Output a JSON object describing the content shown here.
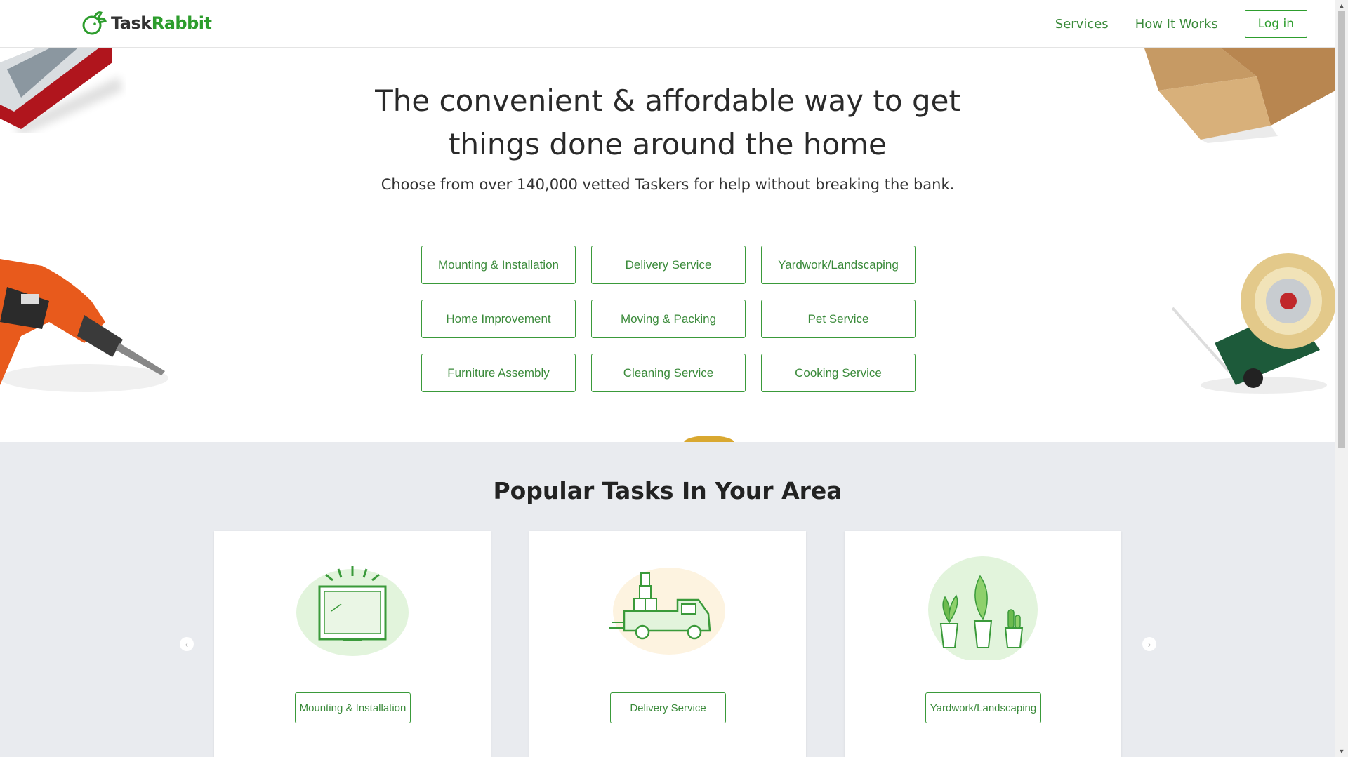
{
  "header": {
    "logo_part1": "Task",
    "logo_part2": "Rabbit",
    "nav": {
      "services": "Services",
      "how_it_works": "How It Works",
      "login": "Log in"
    }
  },
  "hero": {
    "title_line1": "The convenient & affordable way to get",
    "title_line2": "things done around the home",
    "subtitle": "Choose from over 140,000 vetted Taskers for help without breaking the bank.",
    "services": [
      "Mounting & Installation",
      "Delivery Service",
      "Yardwork/Landscaping",
      "Home Improvement",
      "Moving & Packing",
      "Pet Service",
      "Furniture Assembly",
      "Cleaning Service",
      "Cooking Service"
    ]
  },
  "popular": {
    "title": "Popular Tasks In Your Area",
    "cards": [
      {
        "label": "Mounting & Installation",
        "icon": "tv-mount-icon"
      },
      {
        "label": "Delivery Service",
        "icon": "delivery-truck-icon"
      },
      {
        "label": "Yardwork/Landscaping",
        "icon": "potted-plants-icon"
      }
    ],
    "prev_arrow": "‹",
    "next_arrow": "›"
  },
  "colors": {
    "brand_green": "#2d9d2d",
    "section_bg": "#e9ebef"
  }
}
